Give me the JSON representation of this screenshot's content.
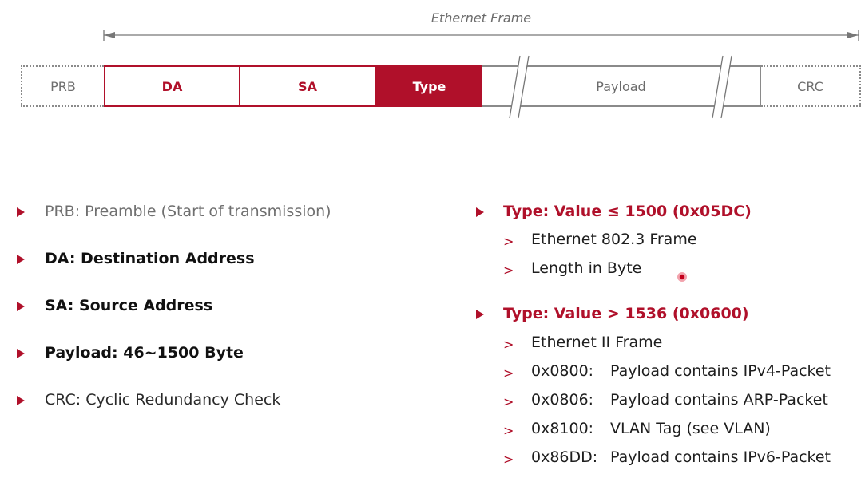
{
  "frame": {
    "title": "Ethernet Frame",
    "fields": {
      "prb": "PRB",
      "da": "DA",
      "sa": "SA",
      "type": "Type",
      "payload": "Payload",
      "crc": "CRC"
    }
  },
  "left_list": [
    {
      "text": "PRB: Preamble (Start of transmission)"
    },
    {
      "text": "DA: Destination Address"
    },
    {
      "text": "SA: Source Address"
    },
    {
      "text": "Payload: 46~1500 Byte"
    },
    {
      "text": "CRC: Cyclic Redundancy Check"
    }
  ],
  "type_small": {
    "heading": "Type: Value ≤ 1500 (0x05DC)",
    "items": [
      "Ethernet 802.3 Frame",
      "Length in Byte"
    ]
  },
  "type_large": {
    "heading": "Type: Value > 1536 (0x0600)",
    "item0": "Ethernet II Frame",
    "codes": [
      {
        "code": "0x0800:",
        "desc": "Payload contains IPv4-Packet"
      },
      {
        "code": "0x0806:",
        "desc": "Payload contains ARP-Packet"
      },
      {
        "code": "0x8100:",
        "desc": "VLAN Tag (see VLAN)"
      },
      {
        "code": "0x86DD:",
        "desc": "Payload contains IPv6-Packet"
      }
    ]
  },
  "colors": {
    "accent": "#b0102a",
    "muted_text": "#6f6f6f",
    "border_gray": "#8a8a8a"
  },
  "icons": {
    "bullet": "triangle-right-icon",
    "sub_bullet": "chevron-right-icon",
    "break_mark": "double-slash-break-icon"
  }
}
